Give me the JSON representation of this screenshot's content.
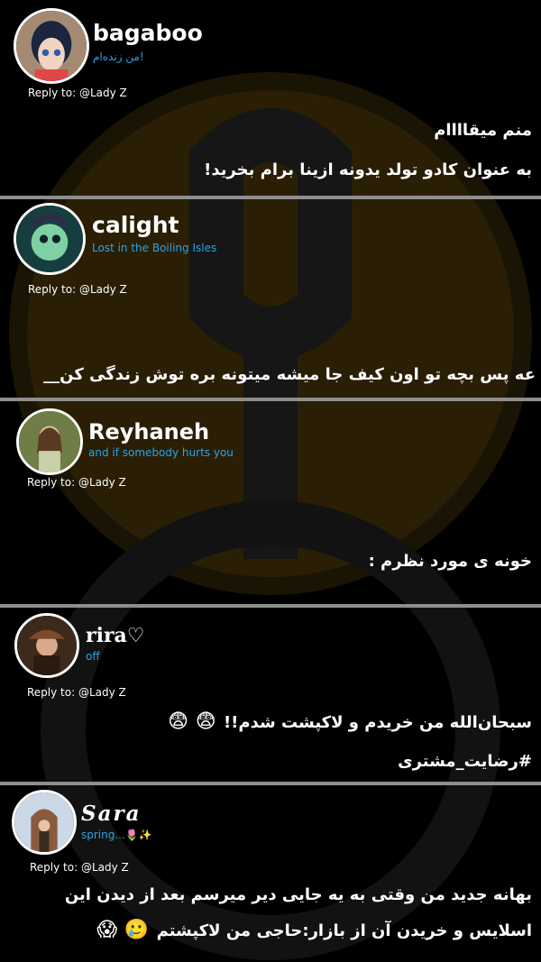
{
  "posts": [
    {
      "username": "bagaboo",
      "status": "من زنده‌ام!",
      "reply": "Reply to: @Lady Z",
      "lines": [
        "منم میقاااام",
        "به عنوان کادو تولد یدونه ازینا برام بخرید!"
      ]
    },
    {
      "username": "calight",
      "status": "Lost in the Boiling Isles",
      "reply": "Reply to: @Lady Z",
      "lines": [
        "عه پس بچه تو اون کیف جا میشه میتونه بره توش زندگی کن__"
      ]
    },
    {
      "username": "Reyhaneh",
      "status": "and if somebody hurts you",
      "reply": "Reply to: @Lady Z",
      "lines": [
        "خونه ی مورد نظرم :"
      ]
    },
    {
      "username": "rira♡",
      "status": "off",
      "reply": "Reply to: @Lady Z",
      "lines": [
        "سبحان‌الله من خریدم و لاکپشت شدم!!",
        "#رضایت_مشتری"
      ],
      "emoji": "😨 😨"
    },
    {
      "username": "Sara",
      "status": "spring...🌷✨",
      "reply": "Reply to: @Lady Z",
      "lines": [
        "بهانه جدید من وقتی به یه جایی دیر میرسم بعد از دیدن این",
        "اسلایس و خریدن آن از بازار:حاجی من لاکپشتم"
      ],
      "emoji": "🥲 😱"
    }
  ]
}
